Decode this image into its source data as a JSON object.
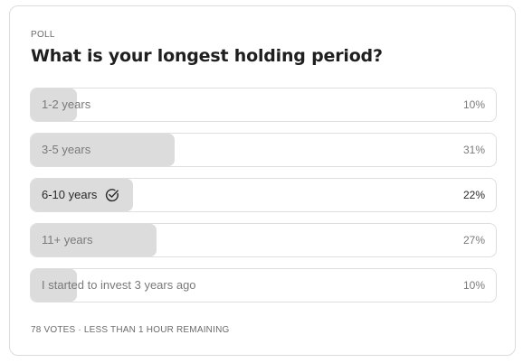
{
  "poll": {
    "eyebrow": "POLL",
    "question": "What is your longest holding period?",
    "options": [
      {
        "label": "1-2 years",
        "percent_text": "10%",
        "percent": 10,
        "selected": false
      },
      {
        "label": "3-5 years",
        "percent_text": "31%",
        "percent": 31,
        "selected": false
      },
      {
        "label": "6-10 years",
        "percent_text": "22%",
        "percent": 22,
        "selected": true
      },
      {
        "label": "11+ years",
        "percent_text": "27%",
        "percent": 27,
        "selected": false
      },
      {
        "label": "I started to invest 3 years ago",
        "percent_text": "10%",
        "percent": 10,
        "selected": false
      }
    ],
    "footer": "78 VOTES · LESS THAN 1 HOUR REMAINING"
  },
  "colors": {
    "bar_fill": "#dcdcdc",
    "border": "#dedede",
    "selected_text": "#2a2a2a",
    "muted_text": "#7a7a7a"
  },
  "icons": {
    "selected_marker": "check-circle-icon"
  }
}
